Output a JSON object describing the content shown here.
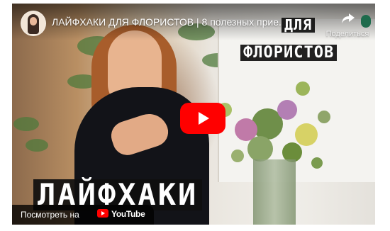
{
  "video": {
    "title": "ЛАЙФХАКИ ДЛЯ ФЛОРИСТОВ | 8 полезных прие...",
    "share_label": "Поделиться",
    "overlay_line1": "ДЛЯ",
    "overlay_line2": "ФЛОРИСТОВ",
    "overlay_line3": "ЛАЙФХАКИ",
    "watch_label": "Посмотреть на",
    "youtube_word": "YouTube"
  },
  "colors": {
    "play_button": "#ff0000",
    "overlay_bg": "#0f0f0f"
  },
  "icons": {
    "share": "share-arrow-icon",
    "play": "play-icon",
    "youtube": "youtube-logo-icon"
  }
}
